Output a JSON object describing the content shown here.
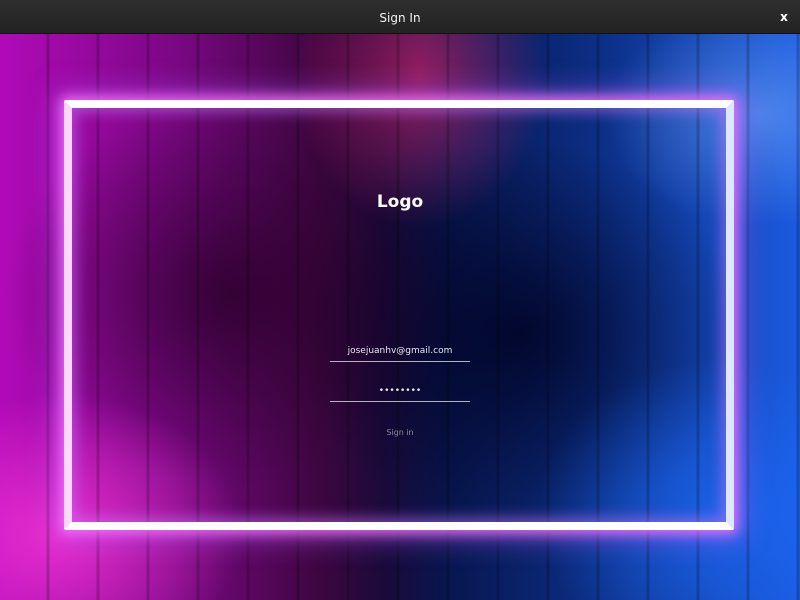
{
  "window": {
    "title": "Sign In",
    "close_label": "x"
  },
  "form": {
    "logo_text": "Logo",
    "email_value": "josejuanhv@gmail.com",
    "password_value": "••••••••",
    "signin_label": "Sign in"
  },
  "colors": {
    "titlebar": "#2a2a2a",
    "neon_frame": "#ffffff",
    "glow_pink": "#ff3cdc",
    "glow_blue": "#1e6eff",
    "signin_text": "#8b8c9a"
  }
}
